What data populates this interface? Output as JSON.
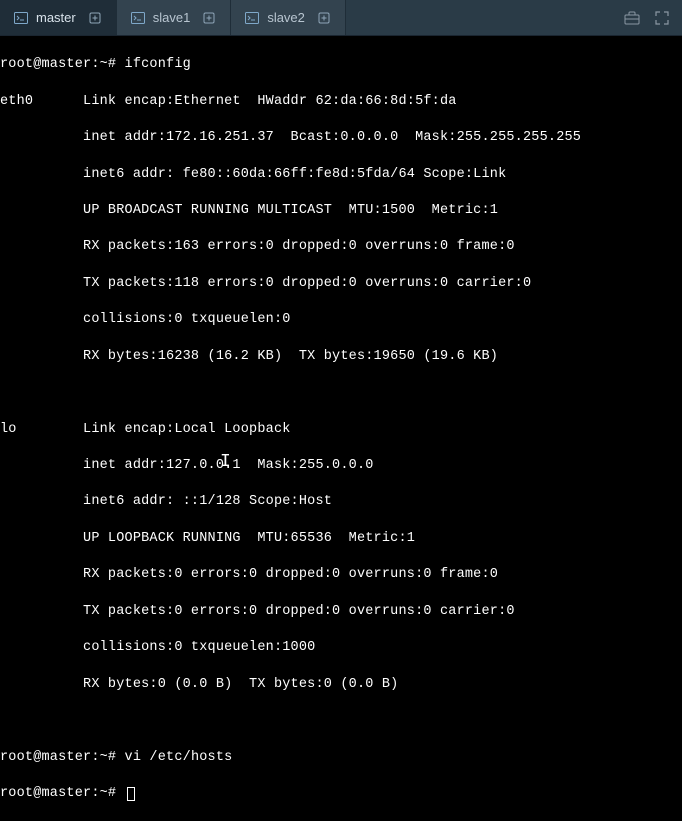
{
  "tabs": [
    {
      "label": "master",
      "active": true
    },
    {
      "label": "slave1",
      "active": false
    },
    {
      "label": "slave2",
      "active": false
    }
  ],
  "terminal": {
    "prompt1": "root@master:~# ",
    "cmd1": "ifconfig",
    "eth0": {
      "name": "eth0",
      "l0": "eth0      Link encap:Ethernet  HWaddr 62:da:66:8d:5f:da",
      "l1": "          inet addr:172.16.251.37  Bcast:0.0.0.0  Mask:255.255.255.255",
      "l2": "          inet6 addr: fe80::60da:66ff:fe8d:5fda/64 Scope:Link",
      "l3": "          UP BROADCAST RUNNING MULTICAST  MTU:1500  Metric:1",
      "l4": "          RX packets:163 errors:0 dropped:0 overruns:0 frame:0",
      "l5": "          TX packets:118 errors:0 dropped:0 overruns:0 carrier:0",
      "l6": "          collisions:0 txqueuelen:0",
      "l7": "          RX bytes:16238 (16.2 KB)  TX bytes:19650 (19.6 KB)"
    },
    "lo": {
      "name": "lo",
      "l0": "lo        Link encap:Local Loopback",
      "l1": "          inet addr:127.0.0.1  Mask:255.0.0.0",
      "l2": "          inet6 addr: ::1/128 Scope:Host",
      "l3": "          UP LOOPBACK RUNNING  MTU:65536  Metric:1",
      "l4": "          RX packets:0 errors:0 dropped:0 overruns:0 frame:0",
      "l5": "          TX packets:0 errors:0 dropped:0 overruns:0 carrier:0",
      "l6": "          collisions:0 txqueuelen:1000",
      "l7": "          RX bytes:0 (0.0 B)  TX bytes:0 (0.0 B)"
    },
    "prompt2": "root@master:~# ",
    "cmd2": "vi /etc/hosts",
    "prompt3": "root@master:~# "
  }
}
